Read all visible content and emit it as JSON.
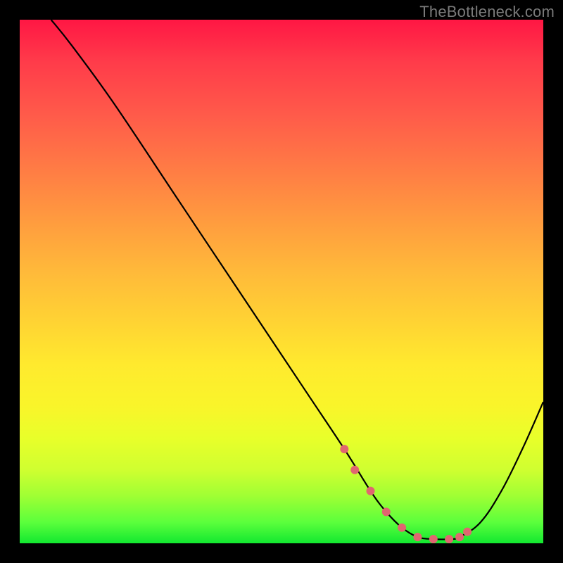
{
  "watermark": "TheBottleneck.com",
  "chart_data": {
    "type": "line",
    "title": "",
    "xlabel": "",
    "ylabel": "",
    "xlim": [
      0,
      100
    ],
    "ylim": [
      0,
      100
    ],
    "series": [
      {
        "name": "curve",
        "color": "#000000",
        "stroke_width": 2.2,
        "x": [
          6,
          10,
          18,
          30,
          42,
          54,
          62,
          67,
          70,
          73,
          76,
          79,
          82,
          84,
          88,
          92,
          96,
          100
        ],
        "y": [
          100,
          95,
          84,
          66,
          48,
          30,
          18,
          10,
          6,
          3,
          1.2,
          0.8,
          0.8,
          1.2,
          4,
          10,
          18,
          27
        ]
      },
      {
        "name": "valley-markers",
        "type": "scatter",
        "color": "#e06670",
        "marker_radius": 6,
        "x": [
          62,
          64,
          67,
          70,
          73,
          76,
          79,
          82,
          84,
          85.5
        ],
        "y": [
          18,
          14,
          10,
          6,
          3,
          1.2,
          0.8,
          0.8,
          1.2,
          2.2
        ]
      }
    ]
  }
}
